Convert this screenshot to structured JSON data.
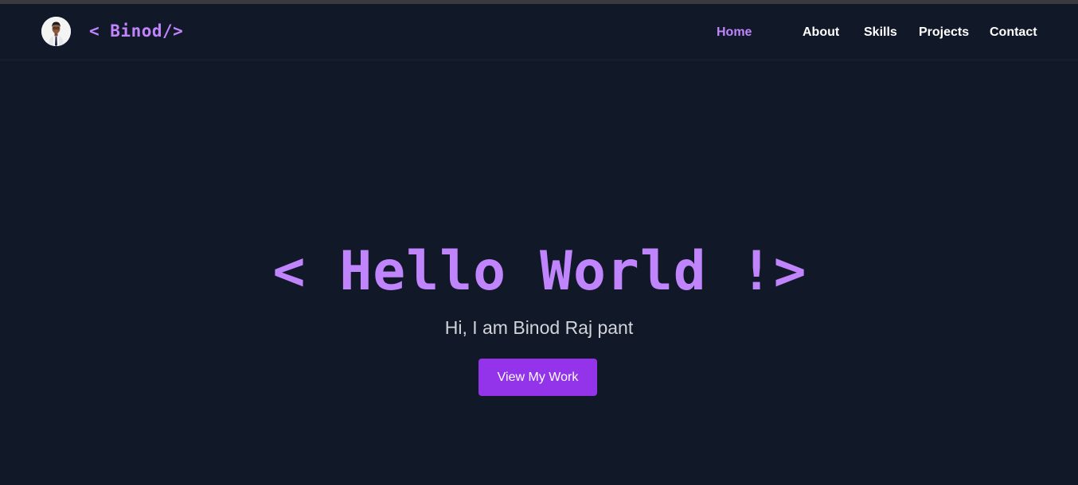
{
  "navbar": {
    "brand": "< Binod/>",
    "avatar_icon": "profile-photo",
    "links": [
      {
        "label": "Home",
        "active": true
      },
      {
        "label": "About",
        "active": false
      },
      {
        "label": "Skills",
        "active": false
      },
      {
        "label": "Projects",
        "active": false
      },
      {
        "label": "Contact",
        "active": false
      }
    ]
  },
  "hero": {
    "title": "< Hello World !>",
    "subtitle": "Hi, I am Binod Raj pant",
    "cta_label": "View My Work"
  },
  "colors": {
    "background": "#111827",
    "accent": "#c084fc",
    "button": "#9333ea",
    "text": "#ffffff",
    "subtitle": "#d1d5db"
  }
}
